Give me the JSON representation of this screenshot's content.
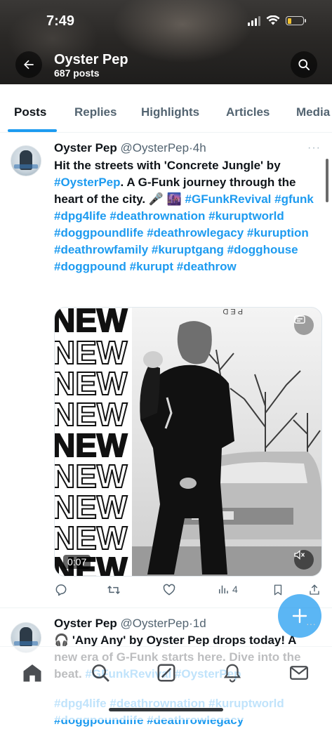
{
  "status_bar": {
    "time": "7:49"
  },
  "header": {
    "title": "Oyster Pep",
    "subtitle": "687 posts"
  },
  "tabs": [
    {
      "label": "Posts",
      "active": true
    },
    {
      "label": "Replies"
    },
    {
      "label": "Highlights"
    },
    {
      "label": "Articles"
    },
    {
      "label": "Media"
    }
  ],
  "tweets": [
    {
      "author": "Oyster Pep",
      "handle": "@OysterPep",
      "separator": "·",
      "time": "4h",
      "body": [
        {
          "t": "Hit the streets with 'Concrete Jungle' by "
        },
        {
          "t": "#OysterPep",
          "tag": true
        },
        {
          "t": ". A G-Funk journey through the heart of the city. 🎤 🌆 "
        },
        {
          "t": "#GFunkRevival",
          "tag": true
        },
        {
          "t": " "
        },
        {
          "t": "#gfunk",
          "tag": true
        },
        {
          "t": " "
        },
        {
          "t": "#dpg4life",
          "tag": true
        },
        {
          "t": " "
        },
        {
          "t": "#deathrownation",
          "tag": true
        },
        {
          "t": " "
        },
        {
          "t": "#kuruptworld",
          "tag": true
        },
        {
          "t": " "
        },
        {
          "t": "#doggpoundlife",
          "tag": true
        },
        {
          "t": " "
        },
        {
          "t": "#deathrowlegacy",
          "tag": true
        },
        {
          "t": " "
        },
        {
          "t": "#kuruption",
          "tag": true
        },
        {
          "t": " "
        },
        {
          "t": "#deathrowfamily",
          "tag": true
        },
        {
          "t": " "
        },
        {
          "t": "#kuruptgang",
          "tag": true
        },
        {
          "t": " "
        },
        {
          "t": "#dogghouse",
          "tag": true
        },
        {
          "t": " "
        },
        {
          "t": "#doggpound",
          "tag": true
        },
        {
          "t": " "
        },
        {
          "t": "#kurupt",
          "tag": true
        },
        {
          "t": " "
        },
        {
          "t": "#deathrow",
          "tag": true
        }
      ],
      "media": {
        "duration": "0:07",
        "repeated_text": [
          "NEW",
          "NEW",
          "NEW",
          "NEW",
          "NEW",
          "NEW",
          "NEW",
          "NEW",
          "NEW",
          "NEW",
          "NEW"
        ]
      },
      "actions": {
        "reply_icon": "reply-icon",
        "repost_icon": "repost-icon",
        "like_icon": "like-icon",
        "views_icon": "views-icon",
        "views_count": "4",
        "bookmark_icon": "bookmark-icon",
        "share_icon": "share-icon"
      }
    },
    {
      "author": "Oyster Pep",
      "handle": "@OysterPep",
      "separator": "·",
      "time": "1d",
      "body": [
        {
          "t": "🎧 'Any Any' by Oyster Pep drops today! A new era of G-Funk starts here. Dive into the beat. "
        },
        {
          "t": "#GFunkRevival",
          "tag": true
        },
        {
          "t": " "
        },
        {
          "t": "#OysterPep",
          "tag": true
        }
      ],
      "body2": [
        {
          "t": "#dpg4life",
          "tag": true
        },
        {
          "t": " "
        },
        {
          "t": "#deathrownation",
          "tag": true
        },
        {
          "t": " "
        },
        {
          "t": "#kuruptworld",
          "tag": true
        },
        {
          "t": " "
        },
        {
          "t": "#doggpoundlife",
          "tag": true
        },
        {
          "t": " "
        },
        {
          "t": "#deathrowlegacy",
          "tag": true
        }
      ]
    }
  ],
  "bottom_nav": [
    "home-icon",
    "search-icon",
    "grok-icon",
    "notifications-icon",
    "messages-icon"
  ],
  "colors": {
    "accent": "#1d9bf0",
    "text": "#0f1419",
    "muted": "#536471"
  }
}
